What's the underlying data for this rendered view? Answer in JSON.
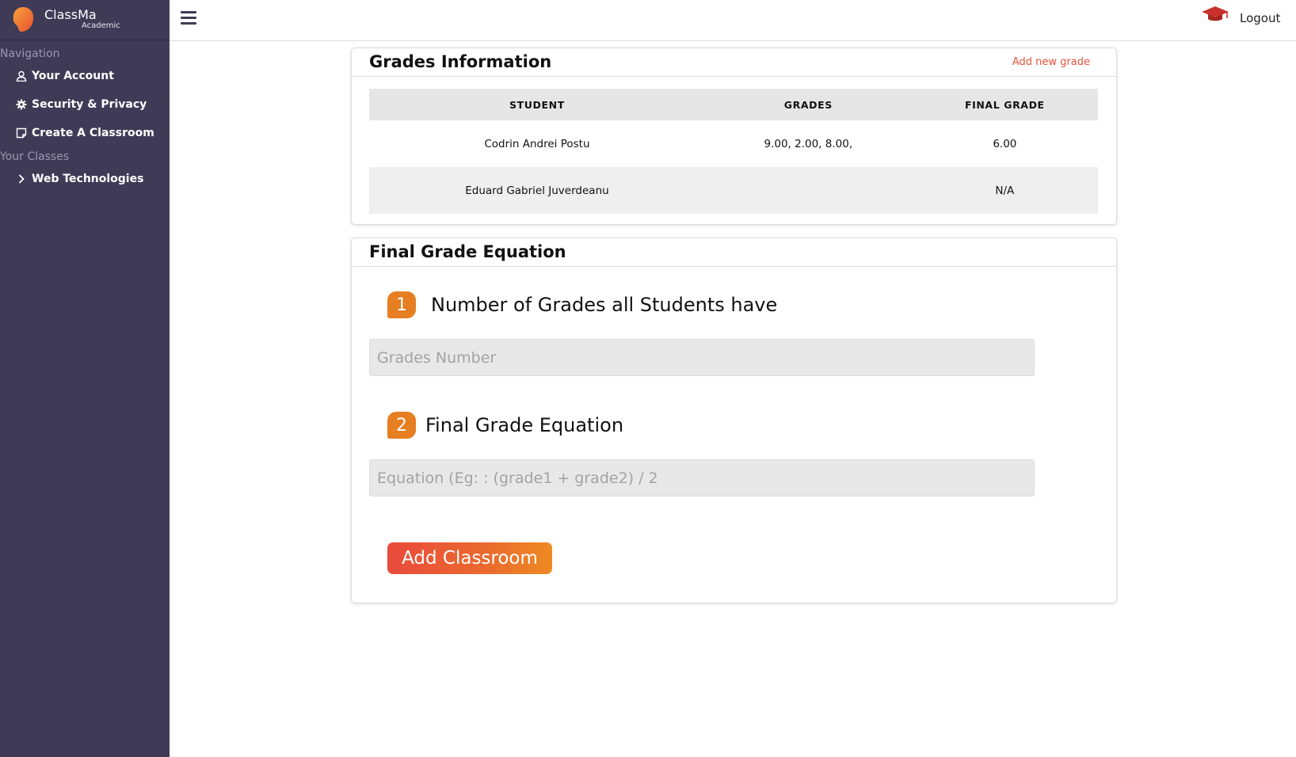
{
  "brand": {
    "name": "ClassMa",
    "subtitle": "Academic"
  },
  "sidebar": {
    "navigation_heading": "Navigation",
    "nav_items": [
      {
        "label": "Your Account",
        "icon": "user-icon"
      },
      {
        "label": "Security & Privacy",
        "icon": "gear-icon"
      },
      {
        "label": "Create A Classroom",
        "icon": "note-icon"
      }
    ],
    "classes_heading": "Your Classes",
    "classes": [
      {
        "label": "Web Technologies",
        "icon": "chevron-right-icon"
      }
    ]
  },
  "topbar": {
    "menu_icon": "hamburger-icon",
    "cap_icon": "graduation-cap-icon",
    "logout_label": "Logout"
  },
  "grades_card": {
    "title": "Grades Information",
    "add_link": "Add new grade",
    "columns": [
      "STUDENT",
      "GRADES",
      "FINAL GRADE"
    ],
    "rows": [
      {
        "student": "Codrin Andrei Postu",
        "grades": "9.00, 2.00, 8.00,",
        "final": "6.00"
      },
      {
        "student": "Eduard Gabriel Juverdeanu",
        "grades": "",
        "final": "N/A"
      }
    ]
  },
  "equation_card": {
    "title": "Final Grade Equation",
    "steps": [
      {
        "number": "1",
        "label": "Number of Grades all Students have"
      },
      {
        "number": "2",
        "label": "Final Grade Equation"
      }
    ],
    "grades_number_placeholder": "Grades Number",
    "equation_placeholder": "Equation (Eg: : (grade1 + grade2) / 2",
    "submit_label": "Add Classroom"
  },
  "colors": {
    "sidebar_bg": "#3f3b57",
    "accent": "#e67e22",
    "link": "#e8533a",
    "button_start": "#e94a3c",
    "button_end": "#ee8a22"
  }
}
